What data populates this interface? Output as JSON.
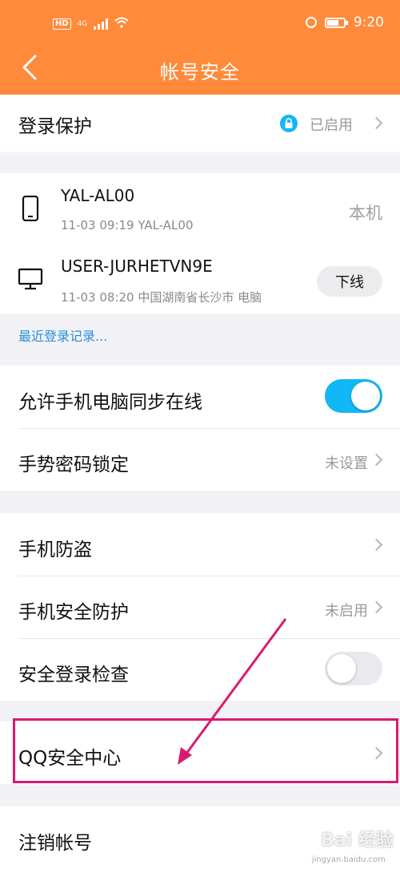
{
  "status_bar": {
    "left_badge": "HD",
    "network": "4G",
    "time": "9:20"
  },
  "header": {
    "title": "帐号安全",
    "back_icon": "chevron-left-icon",
    "background": "#ff8a3a"
  },
  "login_protection": {
    "label": "登录保护",
    "status": "已启用",
    "icon": "lock-icon"
  },
  "devices": [
    {
      "name": "YAL-AL00",
      "meta": "11-03 09:19 YAL-AL00",
      "action": "本机",
      "icon": "phone-icon"
    },
    {
      "name": "USER-JURHETVN9E",
      "meta": "11-03 08:20 中国湖南省长沙市 电脑",
      "action": "下线",
      "icon": "monitor-icon"
    }
  ],
  "recent_login_link": "最近登录记录...",
  "sync_online": {
    "label": "允许手机电脑同步在线",
    "enabled": true
  },
  "gesture_lock": {
    "label": "手势密码锁定",
    "status": "未设置"
  },
  "phone_antitheft": {
    "label": "手机防盗"
  },
  "phone_protection": {
    "label": "手机安全防护",
    "status": "未启用"
  },
  "safe_login_check": {
    "label": "安全登录检查",
    "enabled": false
  },
  "qq_security_center": {
    "label": "QQ安全中心"
  },
  "cancel_account": {
    "label": "注销帐号"
  },
  "colors": {
    "accent": "#12b7f5",
    "highlight": "#d81b6f",
    "link": "#2a8ed6"
  },
  "watermark": {
    "main": "Bai 经验",
    "sub": "jingyan.baidu.com"
  }
}
